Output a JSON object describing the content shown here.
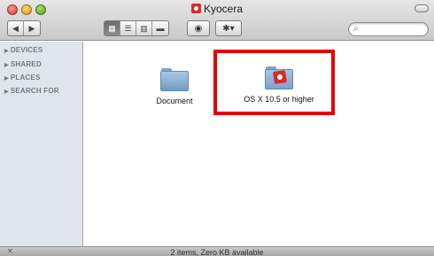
{
  "window": {
    "title": "Kyocera"
  },
  "toolbar": {
    "back_glyph": "◀",
    "forward_glyph": "▶",
    "view_modes": [
      {
        "glyph": "▦",
        "name": "icon-view"
      },
      {
        "glyph": "☰",
        "name": "list-view"
      },
      {
        "glyph": "▥",
        "name": "column-view"
      },
      {
        "glyph": "▬",
        "name": "coverflow-view"
      }
    ],
    "quicklook_glyph": "◉",
    "action_glyph": "✱▾",
    "search_glyph": "⌕",
    "search_placeholder": ""
  },
  "sidebar": {
    "items": [
      {
        "label": "DEVICES"
      },
      {
        "label": "SHARED"
      },
      {
        "label": "PLACES"
      },
      {
        "label": "SEARCH FOR"
      }
    ]
  },
  "content": {
    "files": [
      {
        "label": "Document",
        "icon": "folder-icon"
      },
      {
        "label": "OS X 10.5 or higher",
        "icon": "app-folder-icon"
      }
    ]
  },
  "status": {
    "text": "2 items, Zero KB available"
  },
  "colors": {
    "highlight": "#e60000",
    "sidebar_bg": "#dfe5ec",
    "brand_red": "#d62a2a"
  }
}
